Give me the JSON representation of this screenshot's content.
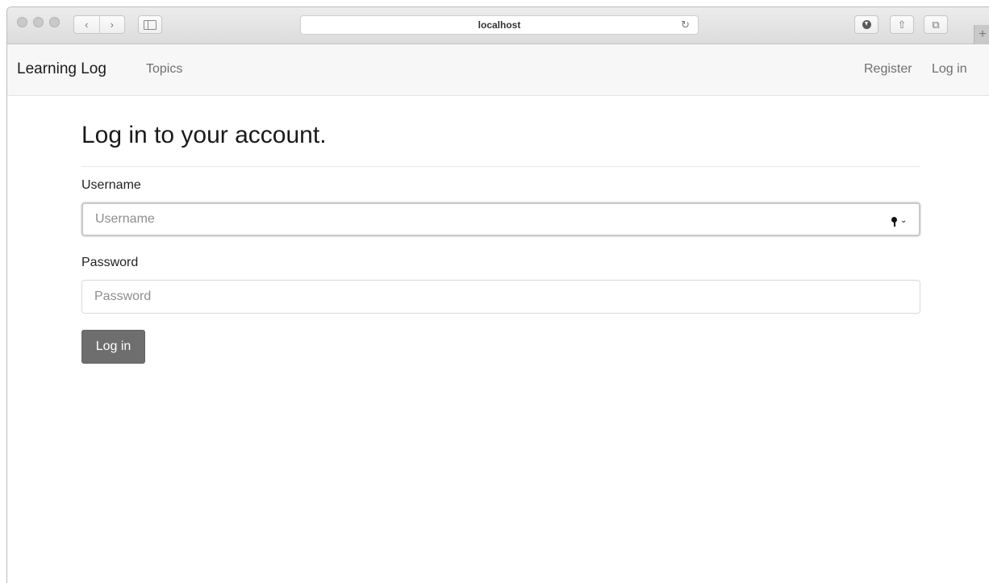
{
  "browser": {
    "url": "localhost",
    "back_icon": "chevron-left-icon",
    "forward_icon": "chevron-right-icon",
    "sidebar_icon": "sidebar-icon",
    "reload_icon": "reload-icon",
    "download_icon": "download-icon",
    "share_icon": "share-icon",
    "tabs_icon": "tabs-icon",
    "new_tab_icon": "plus-icon"
  },
  "navbar": {
    "brand": "Learning Log",
    "topics": "Topics",
    "register": "Register",
    "login": "Log in"
  },
  "form": {
    "title": "Log in to your account.",
    "username_label": "Username",
    "username_placeholder": "Username",
    "password_label": "Password",
    "password_placeholder": "Password",
    "submit": "Log in"
  }
}
